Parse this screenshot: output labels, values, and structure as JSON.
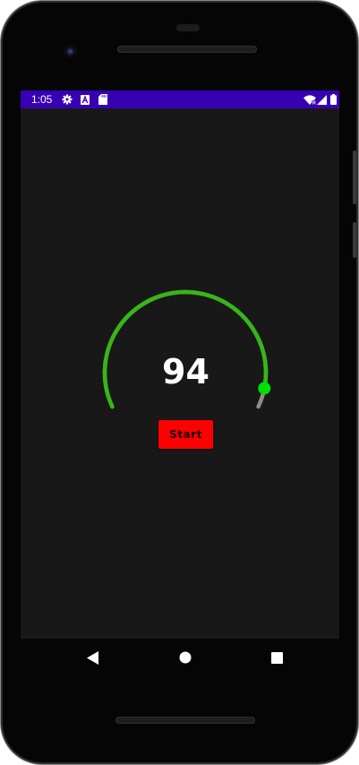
{
  "status_bar": {
    "time": "1:05",
    "background": "#3700b3",
    "left_icons": [
      "settings-gear-icon",
      "a-notification-icon",
      "sd-card-icon"
    ],
    "right_icons": [
      "wifi-icon",
      "signal-icon",
      "battery-icon"
    ]
  },
  "gauge": {
    "value": "94",
    "level": 0.94,
    "progress_color": "#35b715",
    "track_color": "#8c8c8c",
    "thumb_color": "#00e000"
  },
  "controls": {
    "start_label": "Start",
    "start_color": "#ff0000"
  },
  "navigation": {
    "back": "back-icon",
    "home": "home-icon",
    "recents": "recents-icon"
  }
}
